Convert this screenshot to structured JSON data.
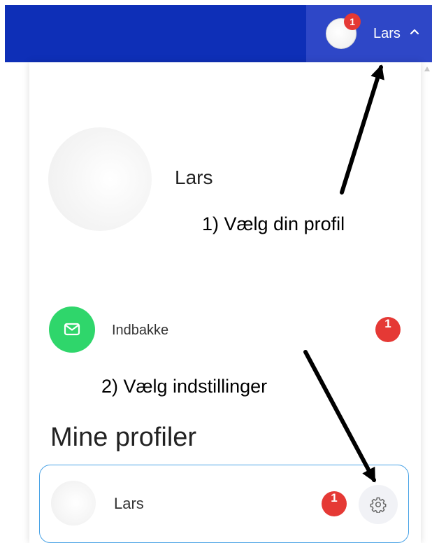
{
  "topbar": {
    "user_name": "Lars",
    "notification_count": "1",
    "brand_color": "#0e2fb7"
  },
  "panel": {
    "profile_name": "Lars",
    "inbox": {
      "label": "Indbakke",
      "count": "1",
      "icon": "mail-icon"
    },
    "section_title": "Mine profiler",
    "profiles": [
      {
        "name": "Lars",
        "count": "1",
        "settings_icon": "gear-icon"
      }
    ]
  },
  "annotations": {
    "step1": "1) Vælg din profil",
    "step2": "2) Vælg indstillinger"
  },
  "colors": {
    "badge": "#e53935",
    "inbox_icon_bg": "#2fd66b",
    "card_border": "#4aa3e6"
  }
}
